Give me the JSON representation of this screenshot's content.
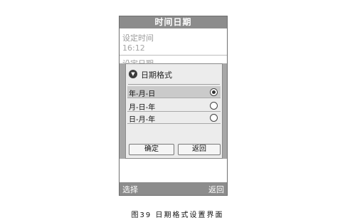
{
  "screen": {
    "title": "时间日期"
  },
  "settings": [
    {
      "label": "设定时间",
      "value": "16:12"
    },
    {
      "label": "设定日期"
    }
  ],
  "dialog": {
    "title": "日期格式",
    "options": [
      "年-月-日",
      "月-日-年",
      "日-月-年"
    ],
    "selected_index": 0,
    "confirm_label": "确定",
    "back_label": "返回"
  },
  "softkeys": {
    "left": "选择",
    "right": "返回"
  },
  "caption": "图39 日期格式设置界面",
  "colors": {
    "bars": "#8c8c8c",
    "dialog_bg": "#ececec",
    "selected_row": "#cacaca"
  },
  "icons": {
    "dialog_icon": "chevron-down-icon",
    "radio": "radio-button-icon"
  }
}
